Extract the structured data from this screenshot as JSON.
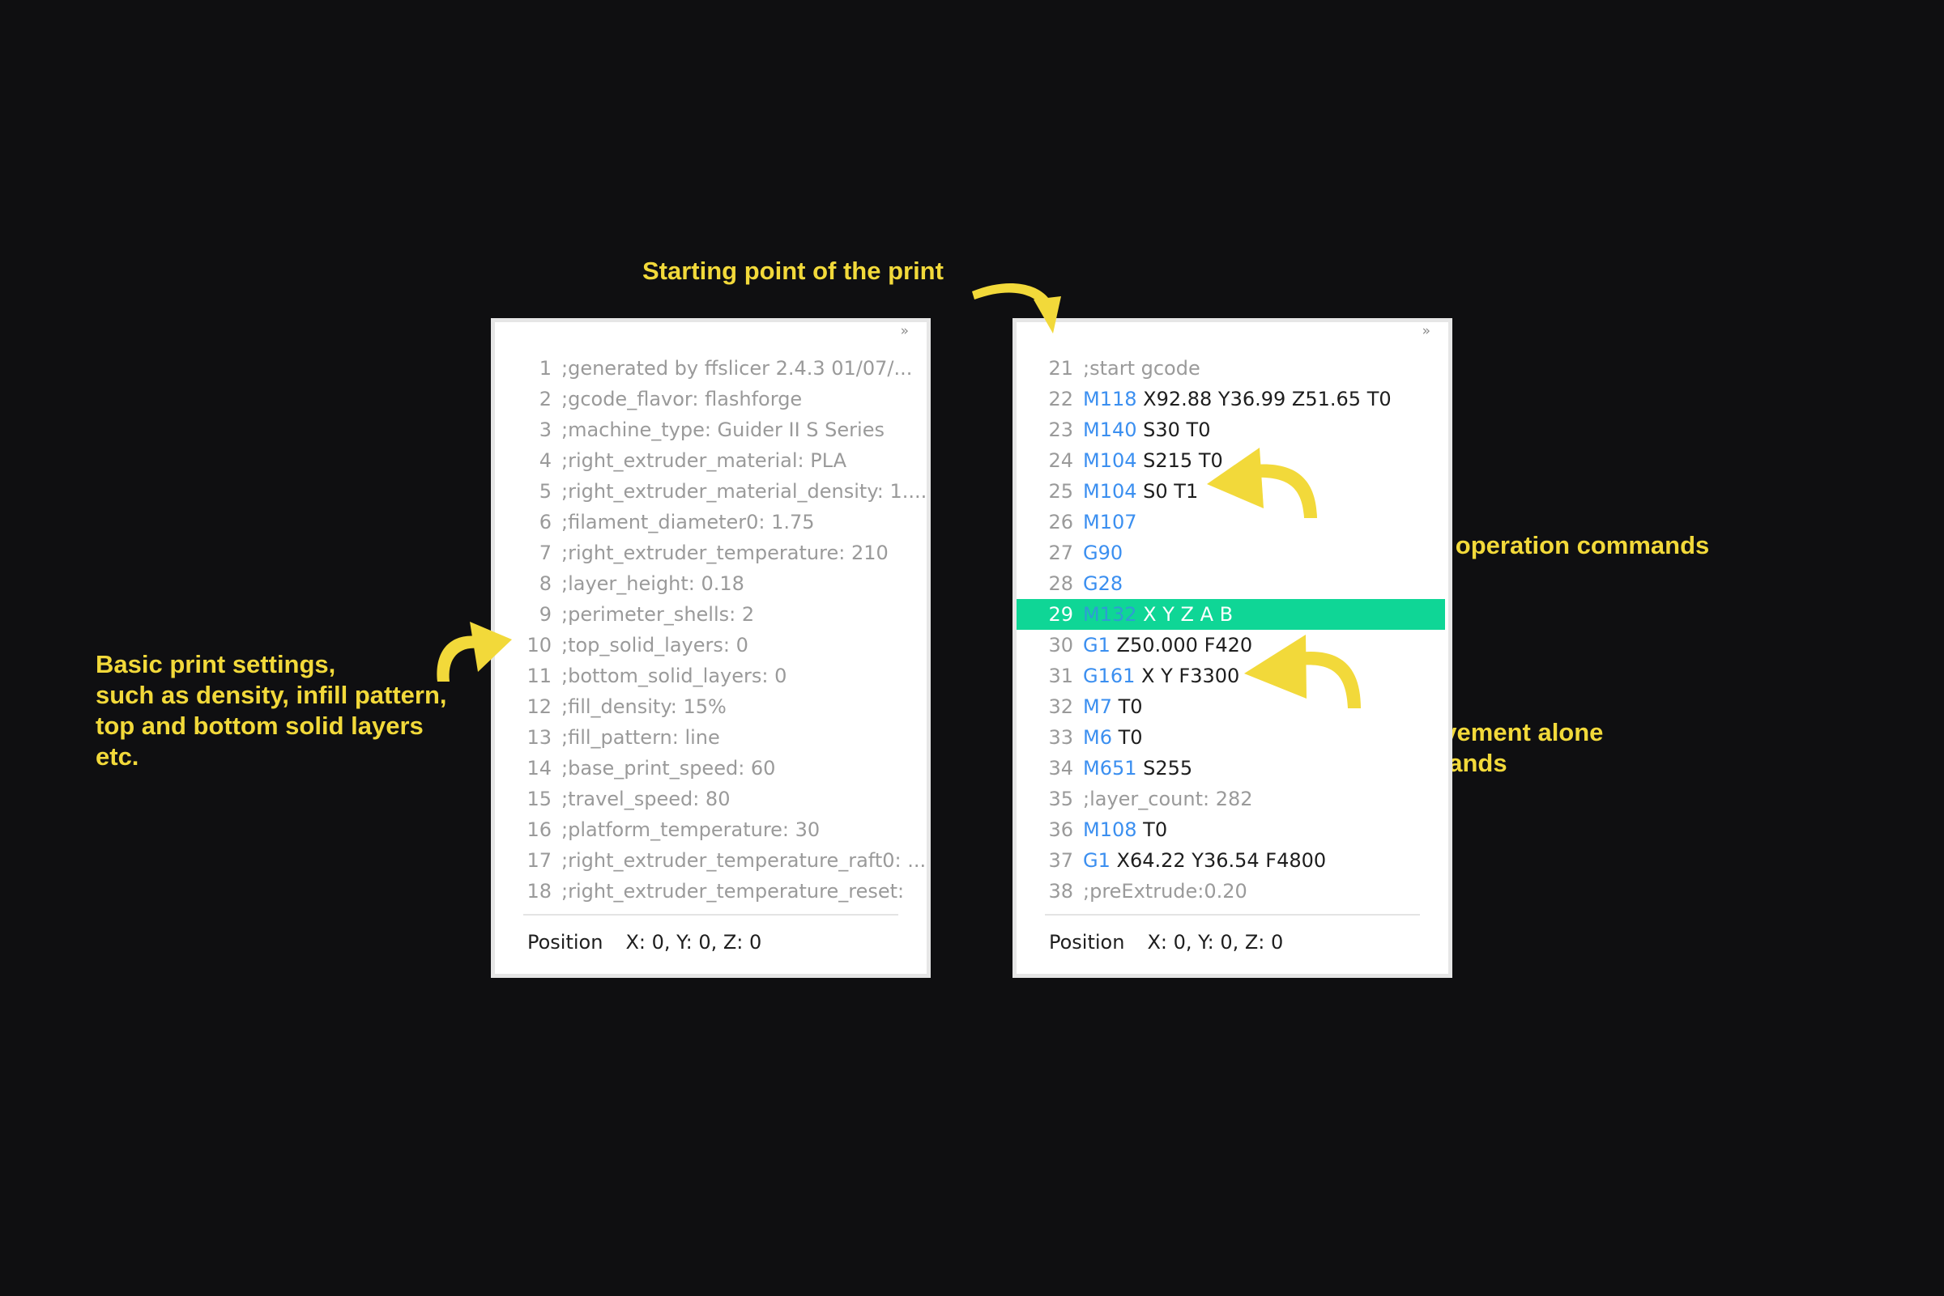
{
  "annotations": {
    "start": "Starting point of the print",
    "equipment": "Equipment operation commands",
    "basic": [
      "Basic print settings,",
      "such as density, infill pattern,",
      "top and bottom solid layers",
      "etc."
    ],
    "nozzle": [
      "Nuzzle movement alone",
      "axis commands"
    ]
  },
  "left_panel": {
    "collapse": "»",
    "lines": [
      {
        "n": "1",
        "text": ";generated by ffslicer 2.4.3 01/07/..."
      },
      {
        "n": "2",
        "text": ";gcode_flavor: flashforge"
      },
      {
        "n": "3",
        "text": ";machine_type: Guider II S Series"
      },
      {
        "n": "4",
        "text": ";right_extruder_material: PLA"
      },
      {
        "n": "5",
        "text": ";right_extruder_material_density: 1...."
      },
      {
        "n": "6",
        "text": ";filament_diameter0: 1.75"
      },
      {
        "n": "7",
        "text": ";right_extruder_temperature: 210"
      },
      {
        "n": "8",
        "text": ";layer_height: 0.18"
      },
      {
        "n": "9",
        "text": ";perimeter_shells: 2"
      },
      {
        "n": "10",
        "text": ";top_solid_layers: 0"
      },
      {
        "n": "11",
        "text": ";bottom_solid_layers: 0"
      },
      {
        "n": "12",
        "text": ";fill_density: 15%"
      },
      {
        "n": "13",
        "text": ";fill_pattern: line"
      },
      {
        "n": "14",
        "text": ";base_print_speed: 60"
      },
      {
        "n": "15",
        "text": ";travel_speed: 80"
      },
      {
        "n": "16",
        "text": ";platform_temperature: 30"
      },
      {
        "n": "17",
        "text": ";right_extruder_temperature_raft0: ..."
      },
      {
        "n": "18",
        "text": ";right_extruder_temperature_reset:"
      }
    ],
    "position_label": "Position",
    "position_value": "X: 0, Y: 0, Z: 0"
  },
  "right_panel": {
    "collapse": "»",
    "lines": [
      {
        "n": "21",
        "comment": ";start gcode"
      },
      {
        "n": "22",
        "cmd": "M118",
        "args": "X92.88 Y36.99 Z51.65 T0"
      },
      {
        "n": "23",
        "cmd": "M140",
        "args": "S30 T0"
      },
      {
        "n": "24",
        "cmd": "M104",
        "args": "S215 T0"
      },
      {
        "n": "25",
        "cmd": "M104",
        "args": "S0 T1"
      },
      {
        "n": "26",
        "cmd": "M107",
        "args": ""
      },
      {
        "n": "27",
        "cmd": "G90",
        "args": ""
      },
      {
        "n": "28",
        "cmd": "G28",
        "args": ""
      },
      {
        "n": "29",
        "cmd": "M132",
        "args": "X Y Z A B",
        "highlight": true
      },
      {
        "n": "30",
        "cmd": "G1",
        "args": "Z50.000 F420"
      },
      {
        "n": "31",
        "cmd": "G161",
        "args": "X Y F3300"
      },
      {
        "n": "32",
        "cmd": "M7",
        "args": "T0"
      },
      {
        "n": "33",
        "cmd": "M6",
        "args": "T0"
      },
      {
        "n": "34",
        "cmd": "M651",
        "args": "S255"
      },
      {
        "n": "35",
        "comment": ";layer_count: 282"
      },
      {
        "n": "36",
        "cmd": "M108",
        "args": "T0"
      },
      {
        "n": "37",
        "cmd": "G1",
        "args": "X64.22 Y36.54 F4800"
      },
      {
        "n": "38",
        "comment": ";preExtrude:0.20"
      }
    ],
    "position_label": "Position",
    "position_value": "X: 0, Y: 0, Z: 0"
  },
  "colors": {
    "background": "#0f0f11",
    "annotation": "#f2d93a",
    "highlight": "#0fd696",
    "command": "#3b8ff0",
    "comment": "#9a9a9a"
  }
}
